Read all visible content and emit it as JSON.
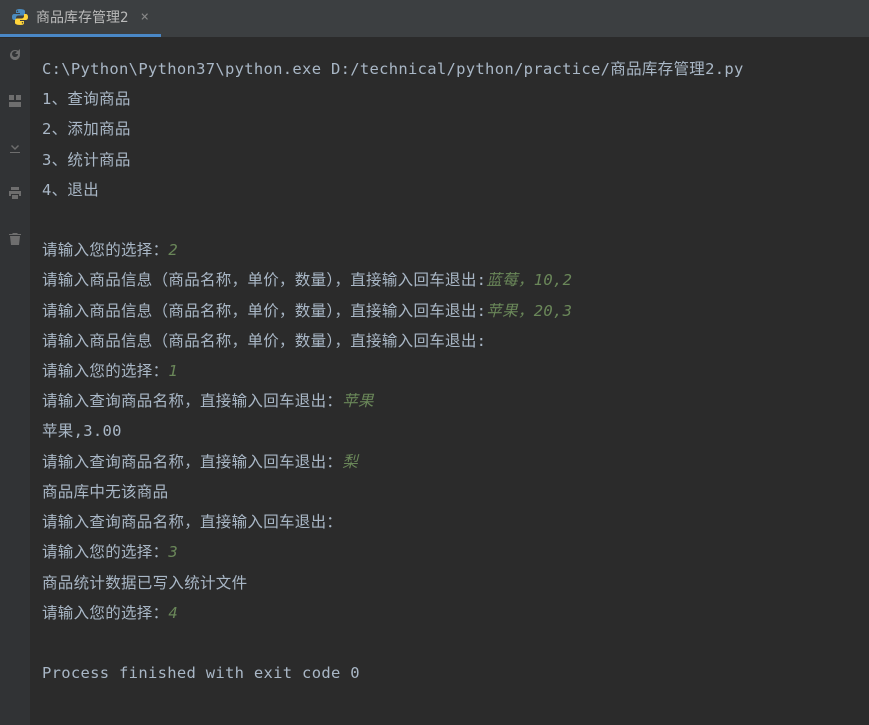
{
  "tab": {
    "title": "商品库存管理2",
    "close": "×"
  },
  "console": {
    "cmd": "C:\\Python\\Python37\\python.exe D:/technical/python/practice/商品库存管理2.py",
    "menu1": "1、查询商品",
    "menu2": "2、添加商品",
    "menu3": "3、统计商品",
    "menu4": "4、退出",
    "prompt_choice": "请输入您的选择：",
    "choice2": "2",
    "prompt_product": "请输入商品信息（商品名称，单价，数量），直接输入回车退出:",
    "input_blueberry": "蓝莓，10,2",
    "input_apple": "苹果，20,3",
    "choice1": "1",
    "prompt_query": "请输入查询商品名称，直接输入回车退出：",
    "query_apple": "苹果",
    "result_apple": "苹果,3.00",
    "query_pear": "梨",
    "result_pear": "商品库中无该商品",
    "choice3": "3",
    "stats_result": "商品统计数据已写入统计文件",
    "choice4": "4",
    "exit_msg": "Process finished with exit code 0"
  }
}
